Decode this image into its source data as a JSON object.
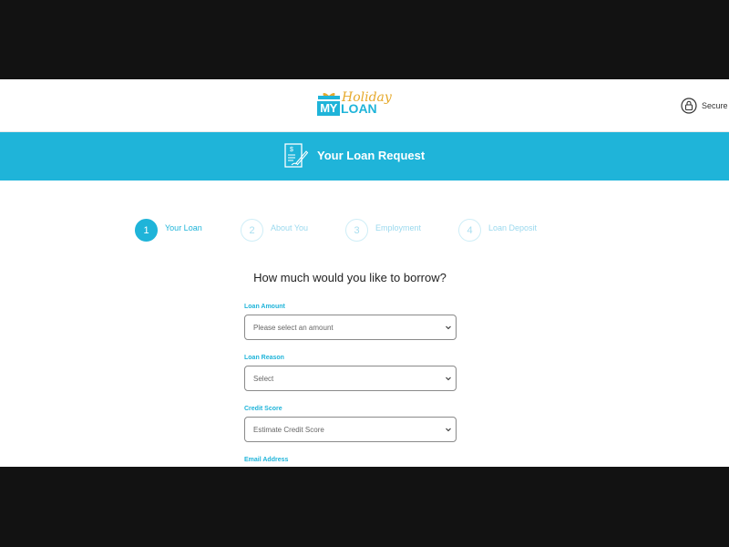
{
  "brand": {
    "my_label": "MY",
    "holiday_label": "Holiday",
    "loan_label": "LOAN"
  },
  "header": {
    "secure_text": "Secure"
  },
  "banner": {
    "title": "Your Loan Request"
  },
  "steps": [
    {
      "number": "1",
      "label": "Your Loan",
      "active": true
    },
    {
      "number": "2",
      "label": "About You",
      "active": false
    },
    {
      "number": "3",
      "label": "Employment",
      "active": false
    },
    {
      "number": "4",
      "label": "Loan Deposit",
      "active": false
    }
  ],
  "form": {
    "question": "How much would you like to borrow?",
    "loan_amount": {
      "label": "Loan Amount",
      "value": "Please select an amount"
    },
    "loan_reason": {
      "label": "Loan Reason",
      "value": "Select"
    },
    "credit_score": {
      "label": "Credit Score",
      "value": "Estimate Credit Score"
    },
    "email": {
      "label": "Email Address"
    }
  },
  "colors": {
    "accent": "#1fb4d9",
    "gold": "#e6a92b"
  }
}
